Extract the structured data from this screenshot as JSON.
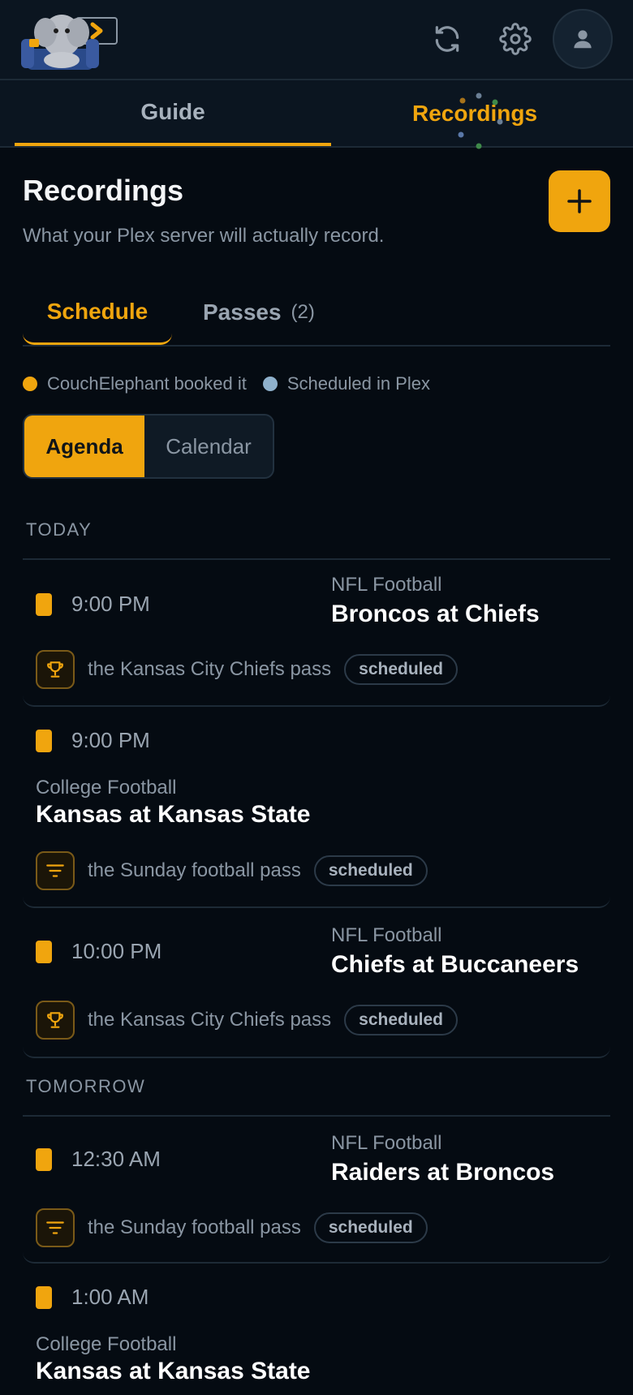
{
  "nav": {
    "tabs": [
      {
        "label": "Guide"
      },
      {
        "label": "Recordings"
      }
    ]
  },
  "header": {
    "title": "Recordings",
    "subtitle": "What your Plex server will actually record."
  },
  "subtabs": {
    "schedule": "Schedule",
    "passes": "Passes",
    "passes_count": "(2)"
  },
  "legend": {
    "booked": "CouchElephant booked it",
    "plex": "Scheduled in Plex"
  },
  "view_toggle": {
    "agenda": "Agenda",
    "calendar": "Calendar"
  },
  "colors": {
    "accent": "#f0a50e",
    "plex_dot": "#8fb1cc",
    "background": "#050b12"
  },
  "days": [
    {
      "label": "TODAY"
    },
    {
      "label": "TOMORROW"
    }
  ],
  "recordings": [
    {
      "time": "9:00 PM",
      "category": "NFL Football",
      "title": "Broncos at Chiefs",
      "pass": "the Kansas City Chiefs pass",
      "pass_icon": "trophy-icon",
      "status": "scheduled"
    },
    {
      "time": "9:00 PM",
      "category": "College Football",
      "title": "Kansas at Kansas State",
      "pass": "the Sunday football pass",
      "pass_icon": "filter-icon",
      "status": "scheduled"
    },
    {
      "time": "10:00 PM",
      "category": "NFL Football",
      "title": "Chiefs at Buccaneers",
      "pass": "the Kansas City Chiefs pass",
      "pass_icon": "trophy-icon",
      "status": "scheduled"
    },
    {
      "time": "12:30 AM",
      "category": "NFL Football",
      "title": "Raiders at Broncos",
      "pass": "the Sunday football pass",
      "pass_icon": "filter-icon",
      "status": "scheduled"
    },
    {
      "time": "1:00 AM",
      "category": "College Football",
      "title": "Kansas at Kansas State"
    }
  ]
}
